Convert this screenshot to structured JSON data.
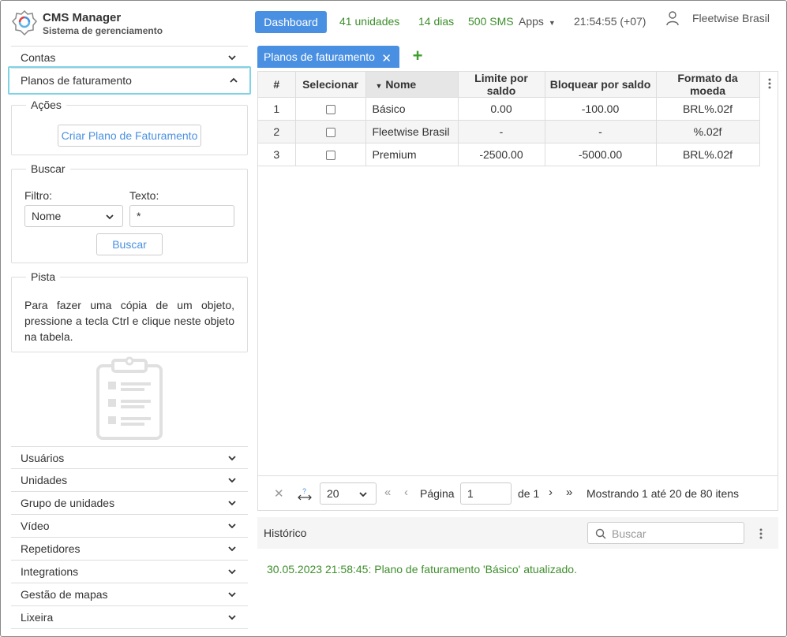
{
  "brand": {
    "title": "CMS Manager",
    "subtitle": "Sistema de gerenciamento"
  },
  "header": {
    "dashboard_label": "Dashboard",
    "units": "41 unidades",
    "days": "14 dias",
    "sms": "500 SMS",
    "apps_label": "Apps",
    "time": "21:54:55 (+07)",
    "user": "Fleetwise Brasil",
    "stat_color": "#3e8e2c",
    "accent": "#4a90e2"
  },
  "sidebar": {
    "contas": "Contas",
    "planos": "Planos de faturamento",
    "acoes": {
      "legend": "Ações",
      "create_label": "Criar Plano de Faturamento"
    },
    "buscar": {
      "legend": "Buscar",
      "filter_label": "Filtro:",
      "filter_value": "Nome",
      "text_label": "Texto:",
      "text_value": "*",
      "button_label": "Buscar"
    },
    "pista": {
      "legend": "Pista",
      "text": "Para fazer uma cópia de um objeto, pressione a tecla Ctrl e clique neste objeto na tabela."
    },
    "bottom_items": [
      "Usuários",
      "Unidades",
      "Grupo de unidades",
      "Vídeo",
      "Repetidores",
      "Integrations",
      "Gestão de mapas",
      "Lixeira"
    ]
  },
  "tabs": [
    {
      "label": "Planos de faturamento"
    }
  ],
  "table": {
    "headers": [
      "#",
      "Selecionar",
      "Nome",
      "Limite por saldo",
      "Bloquear por saldo",
      "Formato da moeda"
    ],
    "rows": [
      [
        "1",
        "",
        "Básico",
        "0.00",
        "-100.00",
        "BRL%.02f"
      ],
      [
        "2",
        "",
        "Fleetwise Brasil",
        "-",
        "-",
        "%.02f"
      ],
      [
        "3",
        "",
        "Premium",
        "-2500.00",
        "-5000.00",
        "BRL%.02f"
      ]
    ]
  },
  "pager": {
    "page_size": "20",
    "page_label": "Página",
    "page_value": "1",
    "of_label": "de 1",
    "showing": "Mostrando 1 até 20 de 80 itens"
  },
  "history": {
    "title": "Histórico",
    "search_placeholder": "Buscar",
    "entries": [
      "30.05.2023 21:58:45: Plano de faturamento 'Básico' atualizado."
    ]
  }
}
